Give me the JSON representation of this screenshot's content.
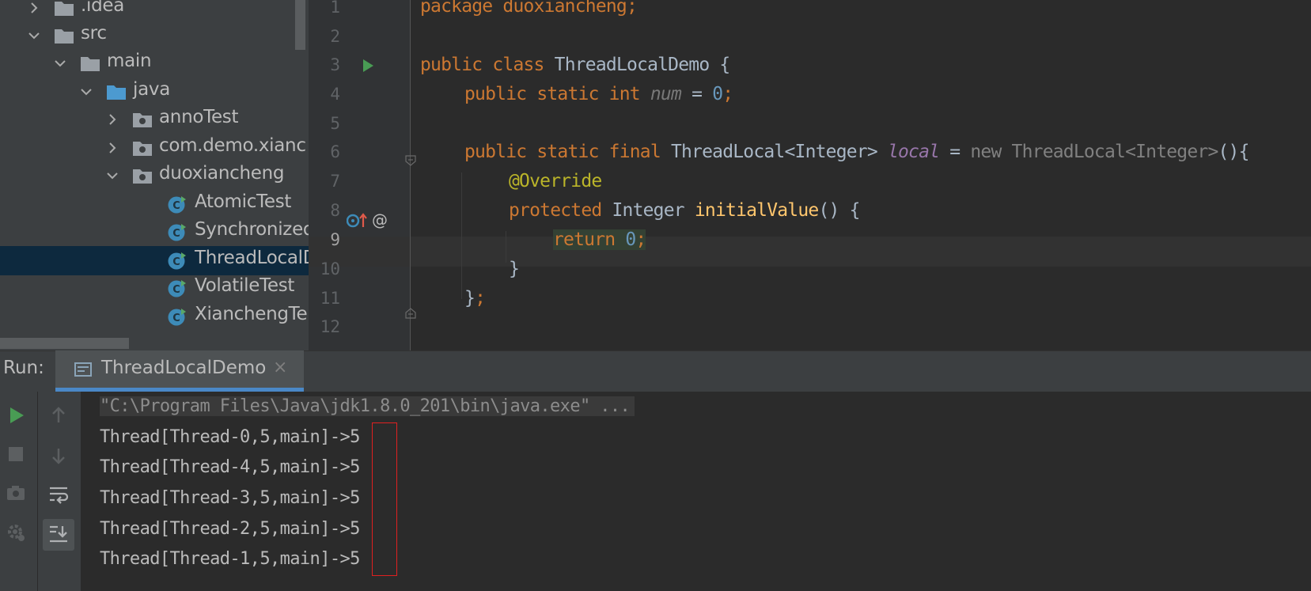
{
  "project_tree": {
    "items": [
      {
        "label": ".idea",
        "type": "folder",
        "expanded": false
      },
      {
        "label": "src",
        "type": "folder",
        "expanded": true
      },
      {
        "label": "main",
        "type": "folder",
        "expanded": true
      },
      {
        "label": "java",
        "type": "source-folder",
        "expanded": true
      },
      {
        "label": "annoTest",
        "type": "package",
        "expanded": false
      },
      {
        "label": "com.demo.xianc",
        "type": "package",
        "expanded": false
      },
      {
        "label": "duoxiancheng",
        "type": "package",
        "expanded": true
      },
      {
        "label": "AtomicTest",
        "type": "class"
      },
      {
        "label": "Synchronized",
        "type": "class"
      },
      {
        "label": "ThreadLocalD",
        "type": "class",
        "selected": true
      },
      {
        "label": "VolatileTest",
        "type": "class"
      },
      {
        "label": "XianchengTe",
        "type": "class"
      }
    ]
  },
  "editor": {
    "current_line": 9,
    "line_numbers": [
      "1",
      "2",
      "3",
      "4",
      "5",
      "6",
      "7",
      "8",
      "9",
      "10",
      "11",
      "12"
    ],
    "lines": {
      "l1": {
        "kw": "package",
        "rest": " duoxiancheng;"
      },
      "l3": {
        "kw1": "public",
        "kw2": "class",
        "name": " ThreadLocalDemo {"
      },
      "l4": {
        "kw": "public static int",
        "field": "num",
        "eq": " = ",
        "num": "0",
        "semi": ";"
      },
      "l6": {
        "kw": "public static final",
        "type": " ThreadLocal<Integer> ",
        "field": "local",
        "eq": " = ",
        "newexpr": "new ThreadLocal<Integer>",
        "tail": "(){"
      },
      "l7": {
        "ann": "@Override"
      },
      "l8": {
        "kw": "protected",
        "type": " Integer ",
        "method": "initialValue",
        "tail": "() {"
      },
      "l9": {
        "kw": "return",
        "num": "0",
        "semi": ";"
      },
      "l10": {
        "text": "}"
      },
      "l11": {
        "brace": "}",
        "semi": ";"
      }
    }
  },
  "run_panel": {
    "label": "Run:",
    "tab_label": "ThreadLocalDemo",
    "close_glyph": "×",
    "console": {
      "command": "\"C:\\Program Files\\Java\\jdk1.8.0_201\\bin\\java.exe\" ...",
      "output": [
        "Thread[Thread-0,5,main]->5",
        "Thread[Thread-4,5,main]->5",
        "Thread[Thread-3,5,main]->5",
        "Thread[Thread-2,5,main]->5",
        "Thread[Thread-1,5,main]->5"
      ]
    },
    "toolbar": [
      "rerun-icon",
      "stop-icon",
      "screenshot-icon",
      "settings-icon",
      "up-arrow-icon",
      "down-arrow-icon",
      "soft-wrap-icon",
      "scroll-to-end-icon"
    ]
  },
  "colors": {
    "keyword": "#cc7832",
    "annotation": "#bbb529",
    "number": "#6897bb",
    "field": "#9876aa",
    "method": "#ffc66d",
    "selection": "#0d293e",
    "highlight_box": "#e02020"
  }
}
